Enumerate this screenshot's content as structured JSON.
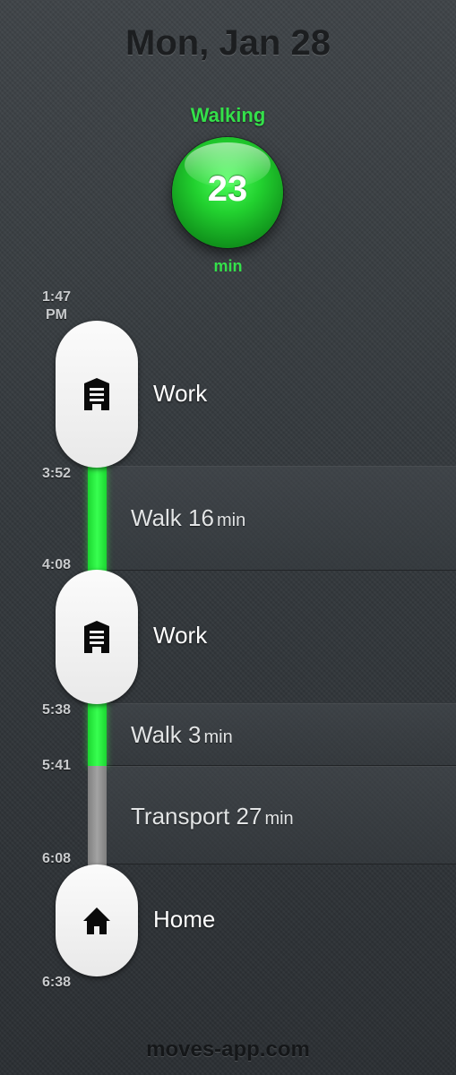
{
  "header": {
    "date": "Mon, Jan 28"
  },
  "summary": {
    "activity": "Walking",
    "value": "23",
    "unit": "min",
    "color": "#34e04a"
  },
  "timeline": {
    "times": [
      "1:47\nPM",
      "3:52",
      "4:08",
      "5:38",
      "5:41",
      "6:08",
      "6:38"
    ],
    "places": [
      {
        "label": "Work",
        "icon": "office-building-icon"
      },
      {
        "label": "Work",
        "icon": "office-building-icon"
      },
      {
        "label": "Home",
        "icon": "house-icon"
      }
    ],
    "segments": [
      {
        "activity": "Walk",
        "duration": "16",
        "unit": "min",
        "color": "#2ee844"
      },
      {
        "activity": "Walk",
        "duration": "3",
        "unit": "min",
        "color": "#2ee844"
      },
      {
        "activity": "Transport",
        "duration": "27",
        "unit": "min",
        "color": "#999999"
      }
    ]
  },
  "footer": {
    "text": "moves-app.com"
  }
}
